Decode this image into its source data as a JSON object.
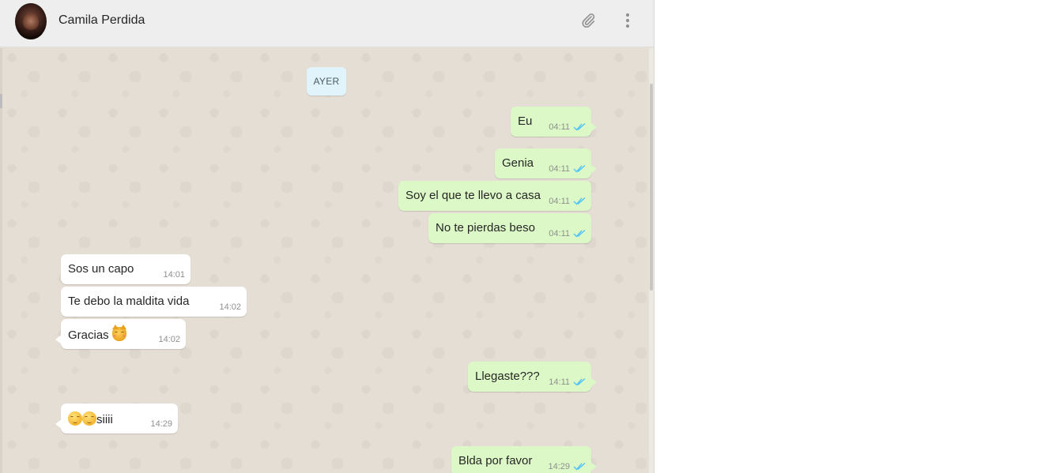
{
  "header": {
    "contact_name": "Camila Perdida",
    "icons": [
      "avatar",
      "paperclip-icon",
      "vertical-dots-menu-icon"
    ]
  },
  "date_divider": "AYER",
  "messages": [
    {
      "direction": "out",
      "text": "Eu",
      "time": "04:11",
      "status": "read"
    },
    {
      "direction": "out",
      "text": "Genia",
      "time": "04:11",
      "status": "read"
    },
    {
      "direction": "out",
      "text": "Soy el que te llevo a casa",
      "time": "04:11",
      "status": "read"
    },
    {
      "direction": "out",
      "text": "No te pierdas beso",
      "time": "04:11",
      "status": "read"
    },
    {
      "direction": "in",
      "text": "Sos un capo",
      "time": "14:01"
    },
    {
      "direction": "in",
      "text": "Te debo la maldita vida",
      "time": "14:02"
    },
    {
      "direction": "in",
      "text": "Gracias",
      "emoji": "kissing-cat-face",
      "time": "14:02"
    },
    {
      "direction": "out",
      "text": "Llegaste???",
      "time": "14:11",
      "status": "read"
    },
    {
      "direction": "in",
      "text": "siiii",
      "emoji": "relieved-face x2",
      "time": "14:29"
    },
    {
      "direction": "out",
      "text": "Blda por favor",
      "time": "14:29",
      "status": "read"
    }
  ],
  "colors": {
    "outgoing_bubble": "#dcf8c6",
    "incoming_bubble": "#ffffff",
    "chat_background": "#e5ded5",
    "header_background": "#eeeeee",
    "read_ticks": "#4fc3f7",
    "date_chip": "#e1f3fb"
  }
}
